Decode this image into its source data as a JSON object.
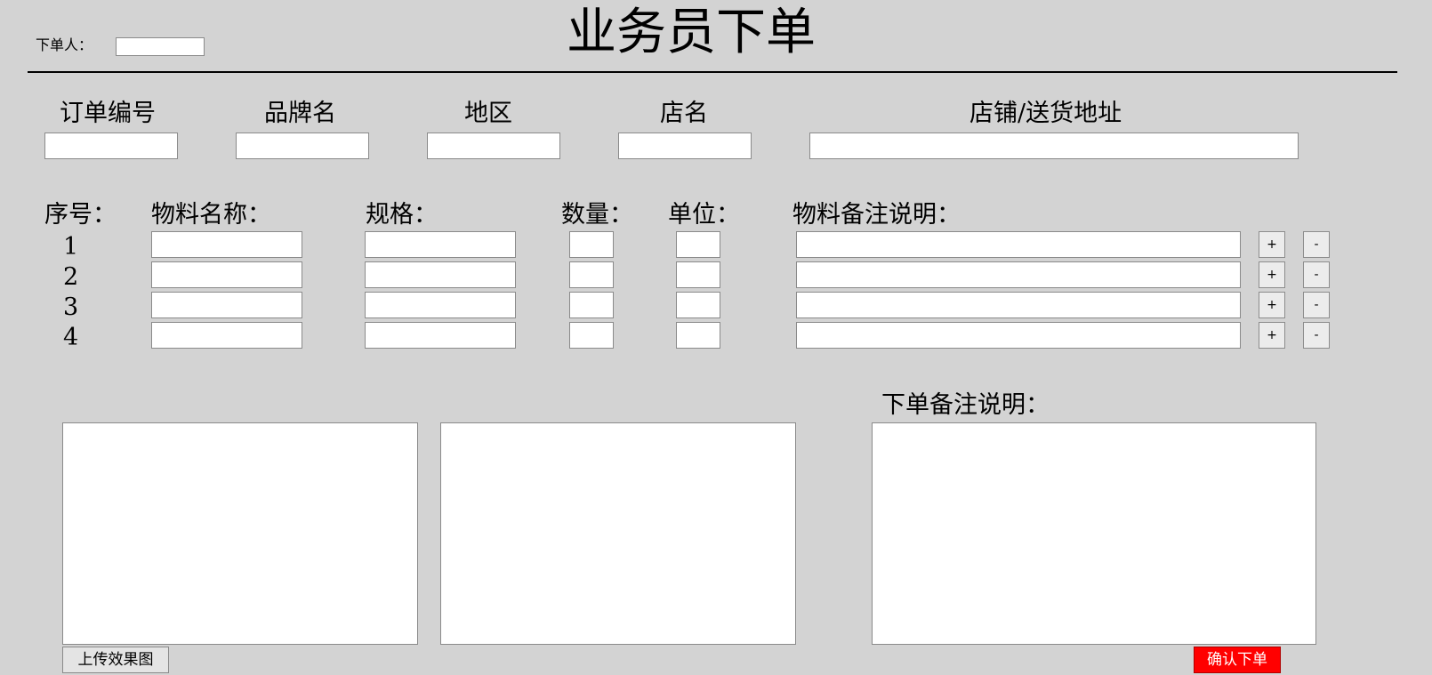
{
  "header": {
    "title": "业务员下单",
    "orderer_label": "下单人：",
    "orderer_value": ""
  },
  "order_fields": [
    {
      "label": "订单编号",
      "value": ""
    },
    {
      "label": "品牌名",
      "value": ""
    },
    {
      "label": "地区",
      "value": ""
    },
    {
      "label": "店名",
      "value": ""
    },
    {
      "label": "店铺/送货地址",
      "value": ""
    }
  ],
  "materials": {
    "headers": {
      "index": "序号：",
      "name": "物料名称：",
      "spec": "规格：",
      "qty": "数量：",
      "unit": "单位：",
      "note": "物料备注说明："
    },
    "rows": [
      {
        "index": "1",
        "name": "",
        "spec": "",
        "qty": "",
        "unit": "",
        "note": ""
      },
      {
        "index": "2",
        "name": "",
        "spec": "",
        "qty": "",
        "unit": "",
        "note": ""
      },
      {
        "index": "3",
        "name": "",
        "spec": "",
        "qty": "",
        "unit": "",
        "note": ""
      },
      {
        "index": "4",
        "name": "",
        "spec": "",
        "qty": "",
        "unit": "",
        "note": ""
      }
    ],
    "add_label": "+",
    "remove_label": "-"
  },
  "upload": {
    "button_label": "上传效果图"
  },
  "order_note": {
    "label": "下单备注说明：",
    "value": ""
  },
  "submit": {
    "label": "确认下单"
  },
  "colors": {
    "background": "#d3d3d3",
    "submit": "#ff0000"
  }
}
